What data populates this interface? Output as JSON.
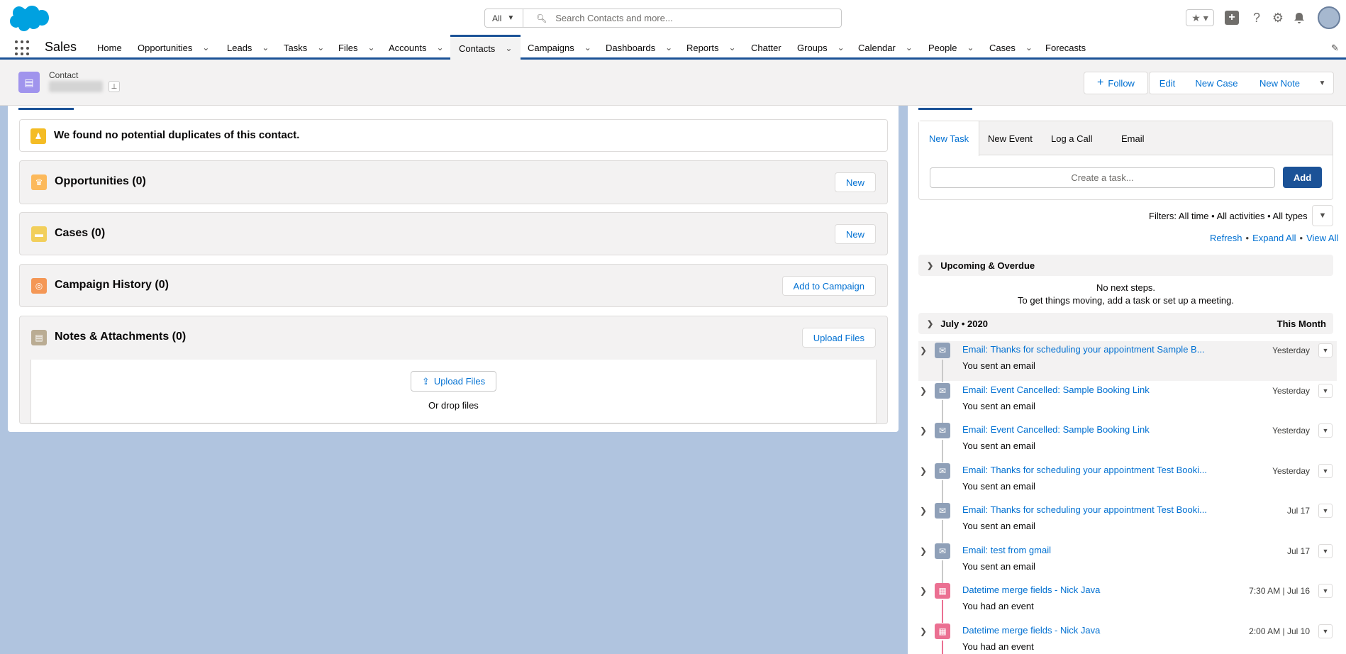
{
  "header": {
    "search_scope": "All",
    "search_placeholder": "Search Contacts and more...",
    "icons": [
      "salesforce-logo",
      "favorites-icon",
      "add-icon",
      "help-icon",
      "setup-gear-icon",
      "notifications-bell-icon",
      "user-avatar"
    ]
  },
  "nav": {
    "app_name": "Sales",
    "items": [
      {
        "label": "Home",
        "dropdown": false
      },
      {
        "label": "Opportunities",
        "dropdown": true
      },
      {
        "label": "Leads",
        "dropdown": true
      },
      {
        "label": "Tasks",
        "dropdown": true
      },
      {
        "label": "Files",
        "dropdown": true
      },
      {
        "label": "Accounts",
        "dropdown": true
      },
      {
        "label": "Contacts",
        "dropdown": true,
        "active": true
      },
      {
        "label": "Campaigns",
        "dropdown": true
      },
      {
        "label": "Dashboards",
        "dropdown": true
      },
      {
        "label": "Reports",
        "dropdown": true
      },
      {
        "label": "Chatter",
        "dropdown": false
      },
      {
        "label": "Groups",
        "dropdown": true
      },
      {
        "label": "Calendar",
        "dropdown": true
      },
      {
        "label": "People",
        "dropdown": true
      },
      {
        "label": "Cases",
        "dropdown": true
      },
      {
        "label": "Forecasts",
        "dropdown": false
      }
    ]
  },
  "record": {
    "type_label": "Contact",
    "actions": {
      "follow": "Follow",
      "edit": "Edit",
      "new_case": "New Case",
      "new_note": "New Note"
    }
  },
  "related": {
    "duplicates_message": "We found no potential duplicates of this contact.",
    "opportunities": {
      "title": "Opportunities (0)",
      "button": "New"
    },
    "cases": {
      "title": "Cases (0)",
      "button": "New"
    },
    "campaign_history": {
      "title": "Campaign History (0)",
      "button": "Add to Campaign"
    },
    "notes_attachments": {
      "title": "Notes & Attachments (0)",
      "button": "Upload Files",
      "upload_label": "Upload Files",
      "drop_text": "Or drop files"
    }
  },
  "activity": {
    "tabs": [
      "New Task",
      "New Event",
      "Log a Call",
      "Email"
    ],
    "task_placeholder": "Create a task...",
    "add_label": "Add",
    "filters_text": "Filters: All time • All activities • All types",
    "links": [
      "Refresh",
      "Expand All",
      "View All"
    ],
    "upcoming": {
      "title": "Upcoming & Overdue",
      "empty1": "No next steps.",
      "empty2": "To get things moving, add a task or set up a meeting."
    },
    "month": {
      "title": "July • 2020",
      "right": "This Month"
    },
    "timeline": [
      {
        "kind": "email",
        "title": "Email: Thanks for scheduling your appointment Sample B...",
        "date": "Yesterday",
        "sub": "You sent an email"
      },
      {
        "kind": "email",
        "title": "Email: Event Cancelled: Sample Booking Link",
        "date": "Yesterday",
        "sub": "You sent an email"
      },
      {
        "kind": "email",
        "title": "Email: Event Cancelled: Sample Booking Link",
        "date": "Yesterday",
        "sub": "You sent an email"
      },
      {
        "kind": "email",
        "title": "Email: Thanks for scheduling your appointment Test Booki...",
        "date": "Yesterday",
        "sub": "You sent an email"
      },
      {
        "kind": "email",
        "title": "Email: Thanks for scheduling your appointment Test Booki...",
        "date": "Jul 17",
        "sub": "You sent an email"
      },
      {
        "kind": "email",
        "title": "Email: test from gmail",
        "date": "Jul 17",
        "sub": "You sent an email"
      },
      {
        "kind": "event",
        "title": "Datetime merge fields - Nick Java",
        "date": "7:30 AM | Jul 16",
        "sub": "You had an event"
      },
      {
        "kind": "event",
        "title": "Datetime merge fields - Nick Java",
        "date": "2:00 AM | Jul 10",
        "sub": "You had an event"
      }
    ]
  },
  "colors": {
    "brand": "#1b5297",
    "link": "#0070d2",
    "email_icon": "#8fa0b8",
    "event_icon": "#eb7092",
    "background": "#b0c4df"
  }
}
